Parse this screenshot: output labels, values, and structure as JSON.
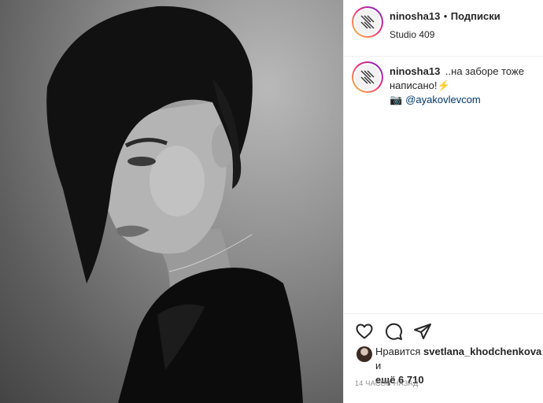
{
  "post": {
    "username": "ninosha13",
    "separator": "•",
    "follow_label": "Подписки",
    "location": "Studio 409",
    "caption_text": "..на заборе тоже написано!",
    "caption_emoji": "⚡",
    "camera_emoji": "📷",
    "mention": "@ayakovlevcom"
  },
  "likes": {
    "prefix": "Нравится",
    "liker": "svetlana_khodchenkova",
    "conj": "и",
    "more": "ещё 6 710"
  },
  "timestamp": "14 часов назад",
  "icons": {
    "like": "heart-icon",
    "comment": "comment-icon",
    "share": "paper-plane-icon"
  },
  "colors": {
    "mention": "#00376b",
    "muted": "#8e8e8e",
    "text": "#262626"
  }
}
